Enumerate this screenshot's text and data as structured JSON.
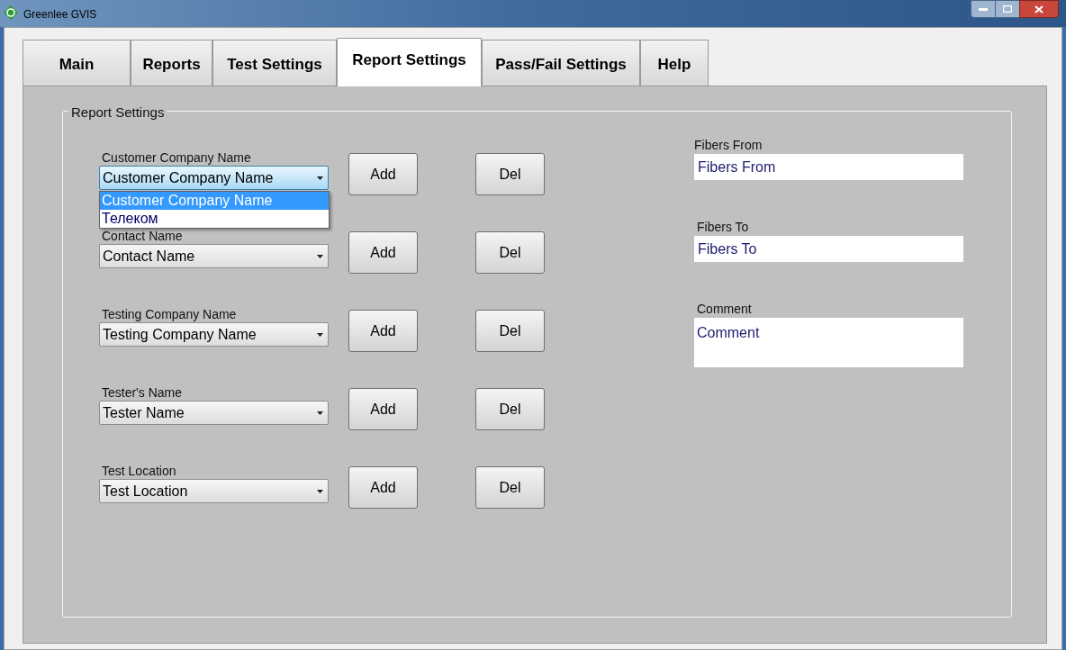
{
  "window": {
    "title": "Greenlee GVIS"
  },
  "tabs": [
    {
      "label": "Main",
      "selected": false
    },
    {
      "label": "Reports",
      "selected": false
    },
    {
      "label": "Test Settings",
      "selected": false
    },
    {
      "label": "Report Settings",
      "selected": true
    },
    {
      "label": "Pass/Fail Settings",
      "selected": false
    },
    {
      "label": "Help",
      "selected": false
    }
  ],
  "group": {
    "title": "Report Settings"
  },
  "rows": [
    {
      "label": "Customer Company Name",
      "value": "Customer Company Name",
      "expanded": true,
      "options": [
        {
          "text": "Customer Company Name",
          "selected": true
        },
        {
          "text": "Телеком",
          "selected": false
        }
      ],
      "add": "Add",
      "del": "Del"
    },
    {
      "label": "Contact Name",
      "value": "Contact Name",
      "expanded": false,
      "add": "Add",
      "del": "Del"
    },
    {
      "label": "Testing Company Name",
      "value": "Testing Company Name",
      "expanded": false,
      "add": "Add",
      "del": "Del"
    },
    {
      "label": "Tester's Name",
      "value": "Tester Name",
      "expanded": false,
      "add": "Add",
      "del": "Del"
    },
    {
      "label": "Test Location",
      "value": "Test Location",
      "expanded": false,
      "add": "Add",
      "del": "Del"
    }
  ],
  "fields": [
    {
      "kind": "line",
      "label": "Fibers From",
      "value": "Fibers From"
    },
    {
      "kind": "line",
      "label": "Fibers To",
      "value": "Fibers To"
    },
    {
      "kind": "area",
      "label": "Comment",
      "value": "Comment"
    }
  ]
}
